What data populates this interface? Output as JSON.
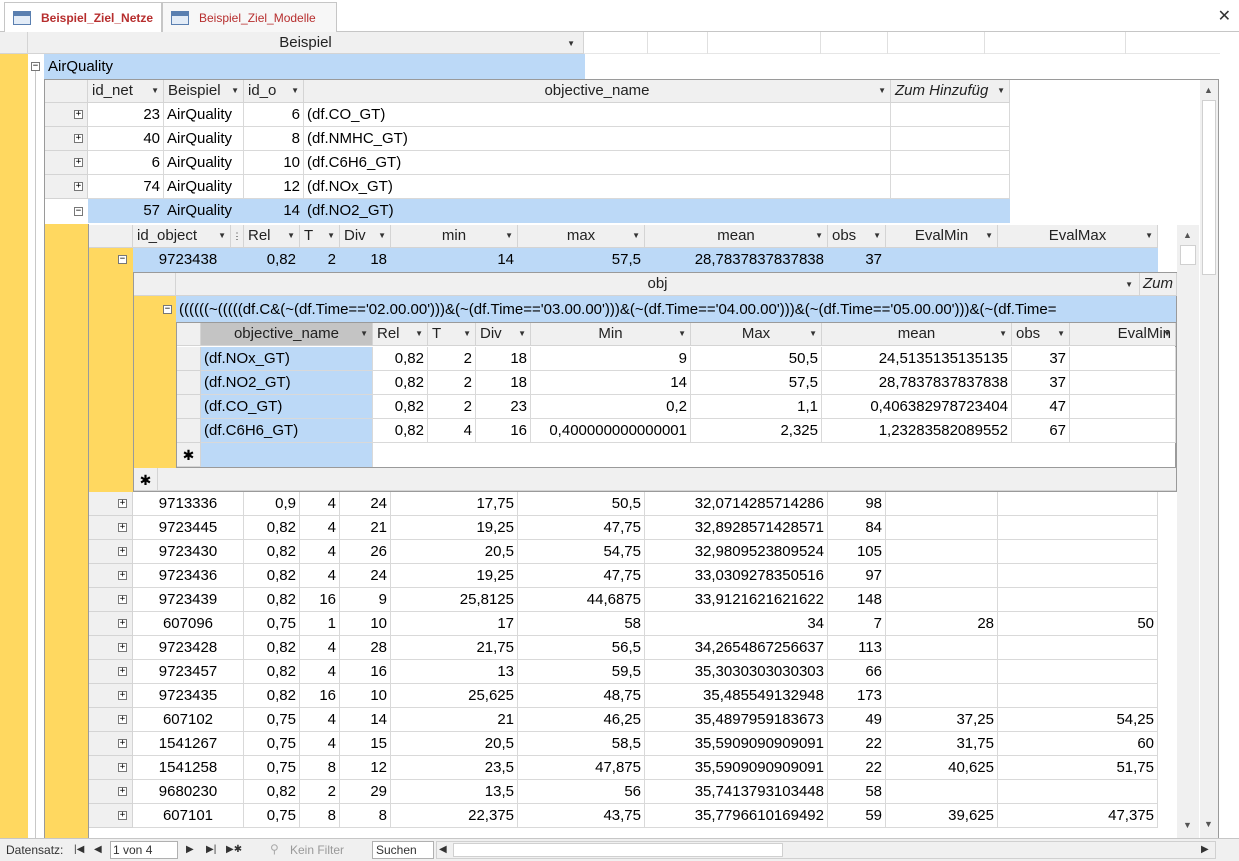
{
  "tabs": [
    {
      "label": "Beispiel_Ziel_Netze",
      "active": true
    },
    {
      "label": "Beispiel_Ziel_Modelle",
      "active": false
    }
  ],
  "level0": {
    "header": "Beispiel",
    "group": "AirQuality"
  },
  "level1": {
    "headers": [
      "id_net",
      "Beispiel",
      "id_o",
      "objective_name",
      "Zum Hinzufüg"
    ],
    "rows": [
      [
        "23",
        "AirQuality",
        "6",
        "(df.CO_GT)"
      ],
      [
        "40",
        "AirQuality",
        "8",
        "(df.NMHC_GT)"
      ],
      [
        "6",
        "AirQuality",
        "10",
        "(df.C6H6_GT)"
      ],
      [
        "74",
        "AirQuality",
        "12",
        "(df.NOx_GT)"
      ],
      [
        "57",
        "AirQuality",
        "14",
        "(df.NO2_GT)"
      ]
    ]
  },
  "level2": {
    "headers": [
      "id_object",
      "Rel",
      "T",
      "Div",
      "min",
      "max",
      "mean",
      "obs",
      "EvalMin",
      "EvalMax"
    ],
    "expanded": [
      "9723438",
      "0,82",
      "2",
      "18",
      "14",
      "57,5",
      "28,7837837837838",
      "37",
      "",
      ""
    ],
    "rows": [
      [
        "9713336",
        "0,9",
        "4",
        "24",
        "17,75",
        "50,5",
        "32,0714285714286",
        "98",
        "",
        ""
      ],
      [
        "9723445",
        "0,82",
        "4",
        "21",
        "19,25",
        "47,75",
        "32,8928571428571",
        "84",
        "",
        ""
      ],
      [
        "9723430",
        "0,82",
        "4",
        "26",
        "20,5",
        "54,75",
        "32,9809523809524",
        "105",
        "",
        ""
      ],
      [
        "9723436",
        "0,82",
        "4",
        "24",
        "19,25",
        "47,75",
        "33,0309278350516",
        "97",
        "",
        ""
      ],
      [
        "9723439",
        "0,82",
        "16",
        "9",
        "25,8125",
        "44,6875",
        "33,9121621621622",
        "148",
        "",
        ""
      ],
      [
        "607096",
        "0,75",
        "1",
        "10",
        "17",
        "58",
        "34",
        "7",
        "28",
        "50"
      ],
      [
        "9723428",
        "0,82",
        "4",
        "28",
        "21,75",
        "56,5",
        "34,2654867256637",
        "113",
        "",
        ""
      ],
      [
        "9723457",
        "0,82",
        "4",
        "16",
        "13",
        "59,5",
        "35,3030303030303",
        "66",
        "",
        ""
      ],
      [
        "9723435",
        "0,82",
        "16",
        "10",
        "25,625",
        "48,75",
        "35,485549132948",
        "173",
        "",
        ""
      ],
      [
        "607102",
        "0,75",
        "4",
        "14",
        "21",
        "46,25",
        "35,4897959183673",
        "49",
        "37,25",
        "54,25"
      ],
      [
        "1541267",
        "0,75",
        "4",
        "15",
        "20,5",
        "58,5",
        "35,5909090909091",
        "22",
        "31,75",
        "60"
      ],
      [
        "1541258",
        "0,75",
        "8",
        "12",
        "23,5",
        "47,875",
        "35,5909090909091",
        "22",
        "40,625",
        "51,75"
      ],
      [
        "9680230",
        "0,82",
        "2",
        "29",
        "13,5",
        "56",
        "35,7413793103448",
        "58",
        "",
        ""
      ],
      [
        "607101",
        "0,75",
        "8",
        "8",
        "22,375",
        "43,75",
        "35,7796610169492",
        "59",
        "39,625",
        "47,375"
      ]
    ]
  },
  "level3": {
    "header": "obj",
    "zum": "Zum",
    "value": "((((((~(((((df.C&(~(df.Time=='02.00.00')))&(~(df.Time=='03.00.00')))&(~(df.Time=='04.00.00')))&(~(df.Time=='05.00.00')))&(~(df.Time="
  },
  "level4": {
    "headers": [
      "objective_name",
      "Rel",
      "T",
      "Div",
      "Min",
      "Max",
      "mean",
      "obs",
      "EvalMin"
    ],
    "rows": [
      [
        "(df.NOx_GT)",
        "0,82",
        "2",
        "18",
        "9",
        "50,5",
        "24,5135135135135",
        "37"
      ],
      [
        "(df.NO2_GT)",
        "0,82",
        "2",
        "18",
        "14",
        "57,5",
        "28,7837837837838",
        "37"
      ],
      [
        "(df.CO_GT)",
        "0,82",
        "2",
        "23",
        "0,2",
        "1,1",
        "0,406382978723404",
        "47"
      ],
      [
        "(df.C6H6_GT)",
        "0,82",
        "4",
        "16",
        "0,400000000000001",
        "2,325",
        "1,23283582089552",
        "67"
      ]
    ]
  },
  "status": {
    "label": "Datensatz:",
    "record": "1 von 4",
    "filter": "Kein Filter",
    "search": "Suchen"
  }
}
